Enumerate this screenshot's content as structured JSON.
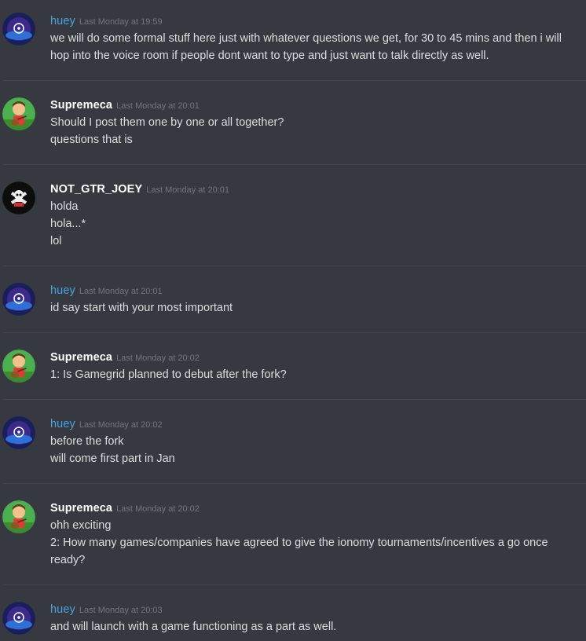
{
  "messages": [
    {
      "author": "huey",
      "timestamp": "Last Monday at 19:59",
      "lines": [
        "we will do some formal stuff here just with whatever questions we get, for 30 to 45 mins and then i will hop into the voice room if people dont want to type and just want to talk directly as well."
      ]
    },
    {
      "author": "Supremeca",
      "timestamp": "Last Monday at 20:01",
      "lines": [
        "Should I post them one by one or all together?",
        "questions that is"
      ]
    },
    {
      "author": "NOT_GTR_JOEY",
      "timestamp": "Last Monday at 20:01",
      "lines": [
        "holda",
        "hola...*",
        "lol"
      ]
    },
    {
      "author": "huey",
      "timestamp": "Last Monday at 20:01",
      "lines": [
        "id say start with your most important"
      ]
    },
    {
      "author": "Supremeca",
      "timestamp": "Last Monday at 20:02",
      "lines": [
        "1: Is Gamegrid planned to debut after the fork?"
      ]
    },
    {
      "author": "huey",
      "timestamp": "Last Monday at 20:02",
      "lines": [
        "before the fork",
        "will come first part in Jan"
      ]
    },
    {
      "author": "Supremeca",
      "timestamp": "Last Monday at 20:02",
      "lines": [
        "ohh exciting",
        "2: How many games/companies have agreed to give the ionomy tournaments/incentives a go once ready?"
      ]
    },
    {
      "author": "huey",
      "timestamp": "Last Monday at 20:03",
      "lines": [
        "and will launch with a game functioning as a part as well."
      ]
    }
  ],
  "colors": {
    "background": "#36393f",
    "huey_name": "#4aa3df",
    "default_name": "#ffffff",
    "text": "#dcddde",
    "timestamp": "#72767d"
  }
}
